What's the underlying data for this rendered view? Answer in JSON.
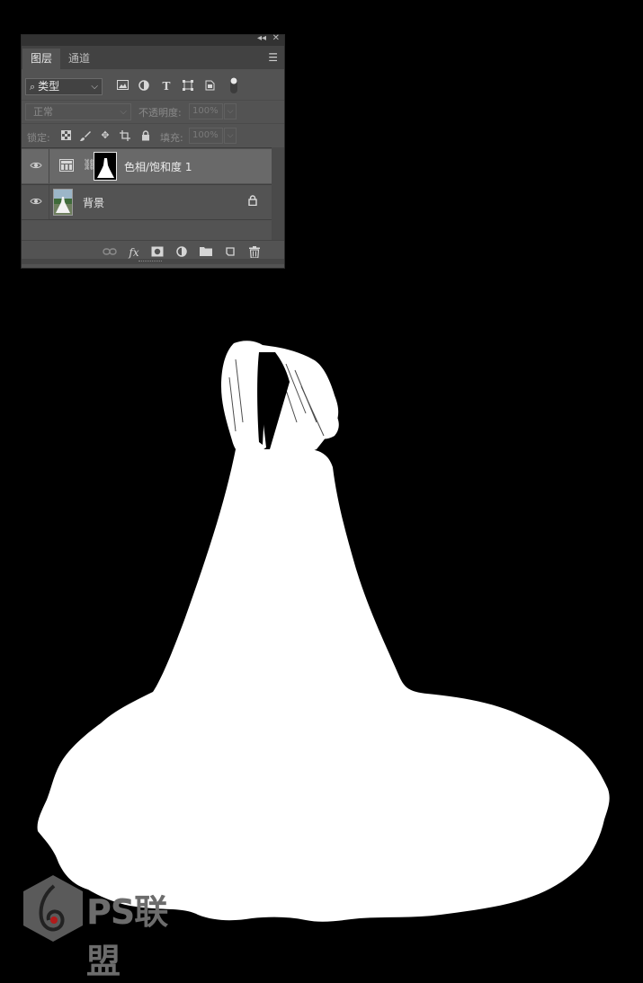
{
  "panel": {
    "tabs": [
      {
        "label": "图层",
        "active": true
      },
      {
        "label": "通道",
        "active": false
      }
    ],
    "filter": {
      "label": "类型"
    },
    "blend_mode": "正常",
    "opacity": {
      "label": "不透明度:",
      "value": "100%"
    },
    "lock": {
      "label": "锁定:"
    },
    "fill": {
      "label": "填充:",
      "value": "100%"
    },
    "layers": [
      {
        "name": "色相/饱和度 1",
        "selected": true,
        "type": "adjustment"
      },
      {
        "name": "背景",
        "selected": false,
        "type": "background",
        "locked": true
      }
    ]
  },
  "icons": {
    "filter_search": "search-icon",
    "filter_image": "image-filter-icon",
    "filter_adjustment": "adjustment-filter-icon",
    "filter_text": "T",
    "filter_shape": "shape-filter-icon",
    "filter_smart": "smart-object-filter-icon",
    "footer": [
      "link-icon",
      "fx",
      "mask-icon",
      "adjustment-icon",
      "folder-icon",
      "new-layer-icon",
      "trash-icon"
    ]
  },
  "colors": {
    "background": "#000000",
    "panel": "#535353",
    "selected_layer": "#696969",
    "silhouette": "#ffffff"
  },
  "watermark": {
    "text": "PS联盟"
  }
}
